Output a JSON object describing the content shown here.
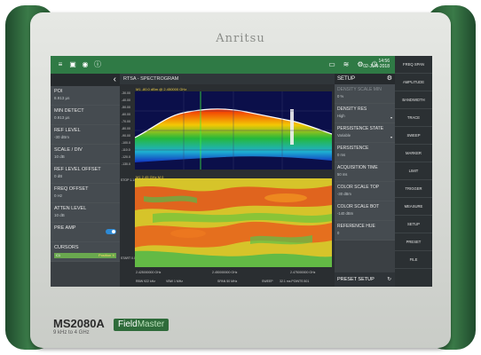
{
  "device": {
    "brand": "Anritsu",
    "model": "MS2080A",
    "model_sub": "9 kHz to 4 GHz",
    "product_line_a": "Field",
    "product_line_b": "Master"
  },
  "topbar": {
    "time": "14:56",
    "date": "02-JUN-2018"
  },
  "left_menu": {
    "items": [
      {
        "label": "POI",
        "value": "8.913 µs"
      },
      {
        "label": "MIN DETECT",
        "value": "0.913 µs"
      },
      {
        "label": "REF LEVEL",
        "value": "-30 dBm"
      },
      {
        "label": "SCALE / DIV",
        "value": "10 dB"
      },
      {
        "label": "REF LEVEL OFFSET",
        "value": "0 dB"
      },
      {
        "label": "FREQ OFFSET",
        "value": "0 Hz"
      },
      {
        "label": "ATTEN LEVEL",
        "value": "10 dB"
      }
    ],
    "preamp_label": "PRE AMP",
    "cursors_label": "CURSORS",
    "cursor_a": "C1",
    "cursor_b": "Position X"
  },
  "center": {
    "title": "RTSA - SPECTROGRAM",
    "trace_header": "M1  -80.0 dBm @ 2.450000 GHz",
    "spec_header": "M1  2.45 GHz  M 0",
    "stop_label": "STOP\n1.14 s",
    "start_label": "START\n0.00 ms",
    "y_ticks": [
      "-30.00",
      "-40.00",
      "-50.00",
      "-60.00",
      "-70.00",
      "-80.00",
      "-90.00",
      "-100.0",
      "-110.0",
      "-120.0",
      "-130.0"
    ],
    "x_labels": [
      "2.425000000 GHz",
      "2.450000000 GHz",
      "2.475000000 GHz"
    ],
    "footer": {
      "rbw": "RBW 922 kHz",
      "vbw": "VBW 1 MHz",
      "span": "SPAN 50 MHz",
      "sweep": "SWEEP",
      "points": "32.1 ms  POINTS 501"
    }
  },
  "setup": {
    "title": "SETUP",
    "items": [
      {
        "label": "DENSITY SCALE MIN",
        "value": "0 %",
        "disabled": true
      },
      {
        "label": "DENSITY RES",
        "value": "High",
        "dropdown": true
      },
      {
        "label": "PERSISTENCE STATE",
        "value": "Variable",
        "dropdown": true
      },
      {
        "label": "PERSISTENCE",
        "value": "0 ms"
      },
      {
        "label": "ACQUISITION TIME",
        "value": "50 ms"
      },
      {
        "label": "COLOR SCALE TOP",
        "value": "-30 dBm"
      },
      {
        "label": "COLOR SCALE BOT",
        "value": "-140 dBm"
      },
      {
        "label": "REFERENCE HUE",
        "value": "0"
      }
    ],
    "preset_label": "PRESET SETUP"
  },
  "right_menu": [
    "FREQ SPAN",
    "AMPLITUDE",
    "BANDWIDTH",
    "TRACE",
    "SWEEP",
    "MARKER",
    "LIMIT",
    "TRIGGER",
    "MEASURE",
    "SETUP",
    "PRESET",
    "FILE"
  ],
  "colors": {
    "accent": "#2f7a45",
    "grip": "#2e6b3a",
    "panel": "#3b4044"
  }
}
